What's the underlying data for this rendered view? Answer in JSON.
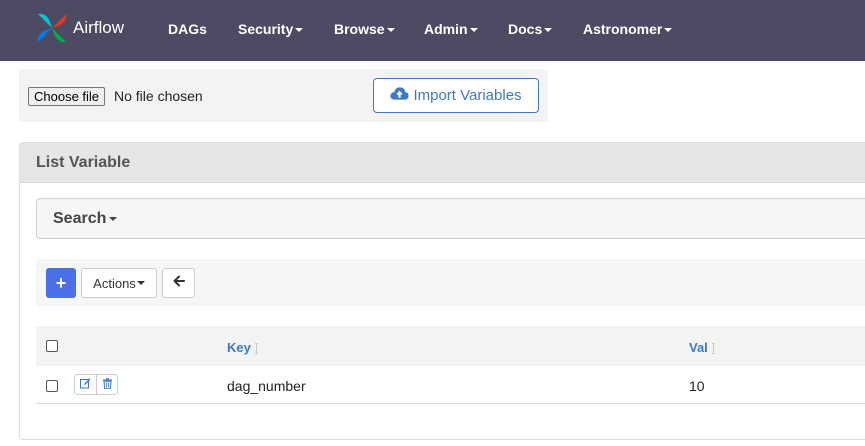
{
  "navbar": {
    "brand": "Airflow",
    "items": [
      {
        "label": "DAGs",
        "dropdown": false
      },
      {
        "label": "Security",
        "dropdown": true
      },
      {
        "label": "Browse",
        "dropdown": true
      },
      {
        "label": "Admin",
        "dropdown": true
      },
      {
        "label": "Docs",
        "dropdown": true
      },
      {
        "label": "Astronomer",
        "dropdown": true
      }
    ]
  },
  "import": {
    "file_button": "Choose file",
    "file_status": "No file chosen",
    "import_button": "Import Variables",
    "import_icon": "cloud-upload-icon"
  },
  "list": {
    "title": "List Variable",
    "search_label": "Search",
    "toolbar": {
      "add_label": "+",
      "actions_label": "Actions",
      "back_icon": "arrow-left-icon"
    },
    "columns": [
      {
        "label": "Key"
      },
      {
        "label": "Val"
      }
    ],
    "rows": [
      {
        "key": "dag_number",
        "val": "10"
      }
    ]
  },
  "colors": {
    "navbar_bg": "#4d4a63",
    "accent": "#3c79c7",
    "add_button": "#4b6fe6"
  }
}
